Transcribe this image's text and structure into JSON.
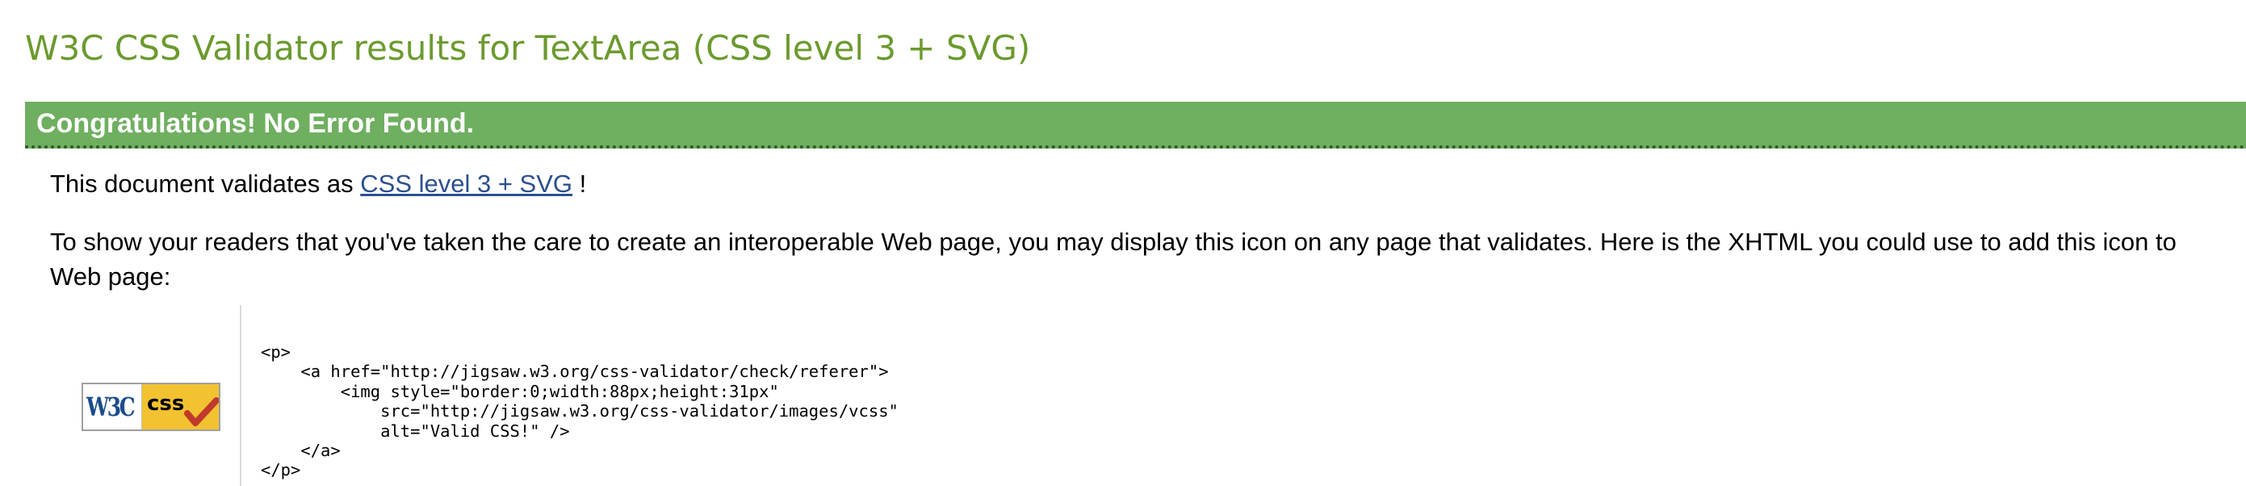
{
  "page": {
    "title": "W3C CSS Validator results for TextArea (CSS level 3 + SVG)"
  },
  "banner": {
    "message": "Congratulations! No Error Found.",
    "color": "#6faf60"
  },
  "validates": {
    "prefix": "This document validates as ",
    "link_text": "CSS level 3 + SVG",
    "suffix": " !"
  },
  "info": {
    "line1": "To show your readers that you've taken the care to create an interoperable Web page, you may display this icon on any page that validates. Here is the XHTML you could use to add this icon to",
    "line2": "Web page:"
  },
  "badge": {
    "left_text": "W3C",
    "right_text": "css",
    "icon": "w3c-valid-css-badge"
  },
  "code": {
    "lines": [
      "<p>",
      "    <a href=\"http://jigsaw.w3.org/css-validator/check/referer\">",
      "        <img style=\"border:0;width:88px;height:31px\"",
      "            src=\"http://jigsaw.w3.org/css-validator/images/vcss\"",
      "            alt=\"Valid CSS!\" />",
      "    </a>",
      "</p>"
    ]
  },
  "colors": {
    "title": "#6b9a2e",
    "link": "#2c508e",
    "badge_blue": "#1c4c8a",
    "badge_gold": "#f2c230",
    "check_red": "#c0392b"
  }
}
